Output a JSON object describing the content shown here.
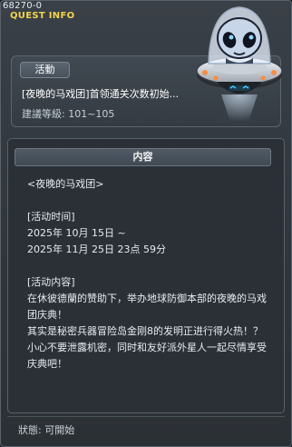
{
  "window": {
    "quest_id": "68270-0",
    "header_title": "QUEST INFO"
  },
  "summary": {
    "tag": "活動",
    "name": "[夜晚的马戏团]首领通关次数初始...",
    "level": "建議等級: 101~105"
  },
  "content": {
    "header": "内容",
    "lines": [
      "<夜晚的马戏团>",
      "",
      "[活动时间]",
      "2025年 10月 15日 ~",
      "2025年 11月 25日 23点 59分",
      "",
      "[活动内容]",
      "在休彼德蘭的赞助下，举办地球防御本部的夜晚的马戏团庆典！",
      "其实是秘密兵器冒险岛金刚8的发明正进行得火热！？",
      "小心不要泄露机密，同时和友好派外星人一起尽情享受庆典吧！"
    ]
  },
  "footer": {
    "status": "狀態: 可開始"
  },
  "colors": {
    "title_accent": "#f2d44a",
    "panel_bg": "#2a3036",
    "text": "#e6ebef"
  },
  "icons": {
    "npc": "alien-ufo-npc-icon"
  }
}
